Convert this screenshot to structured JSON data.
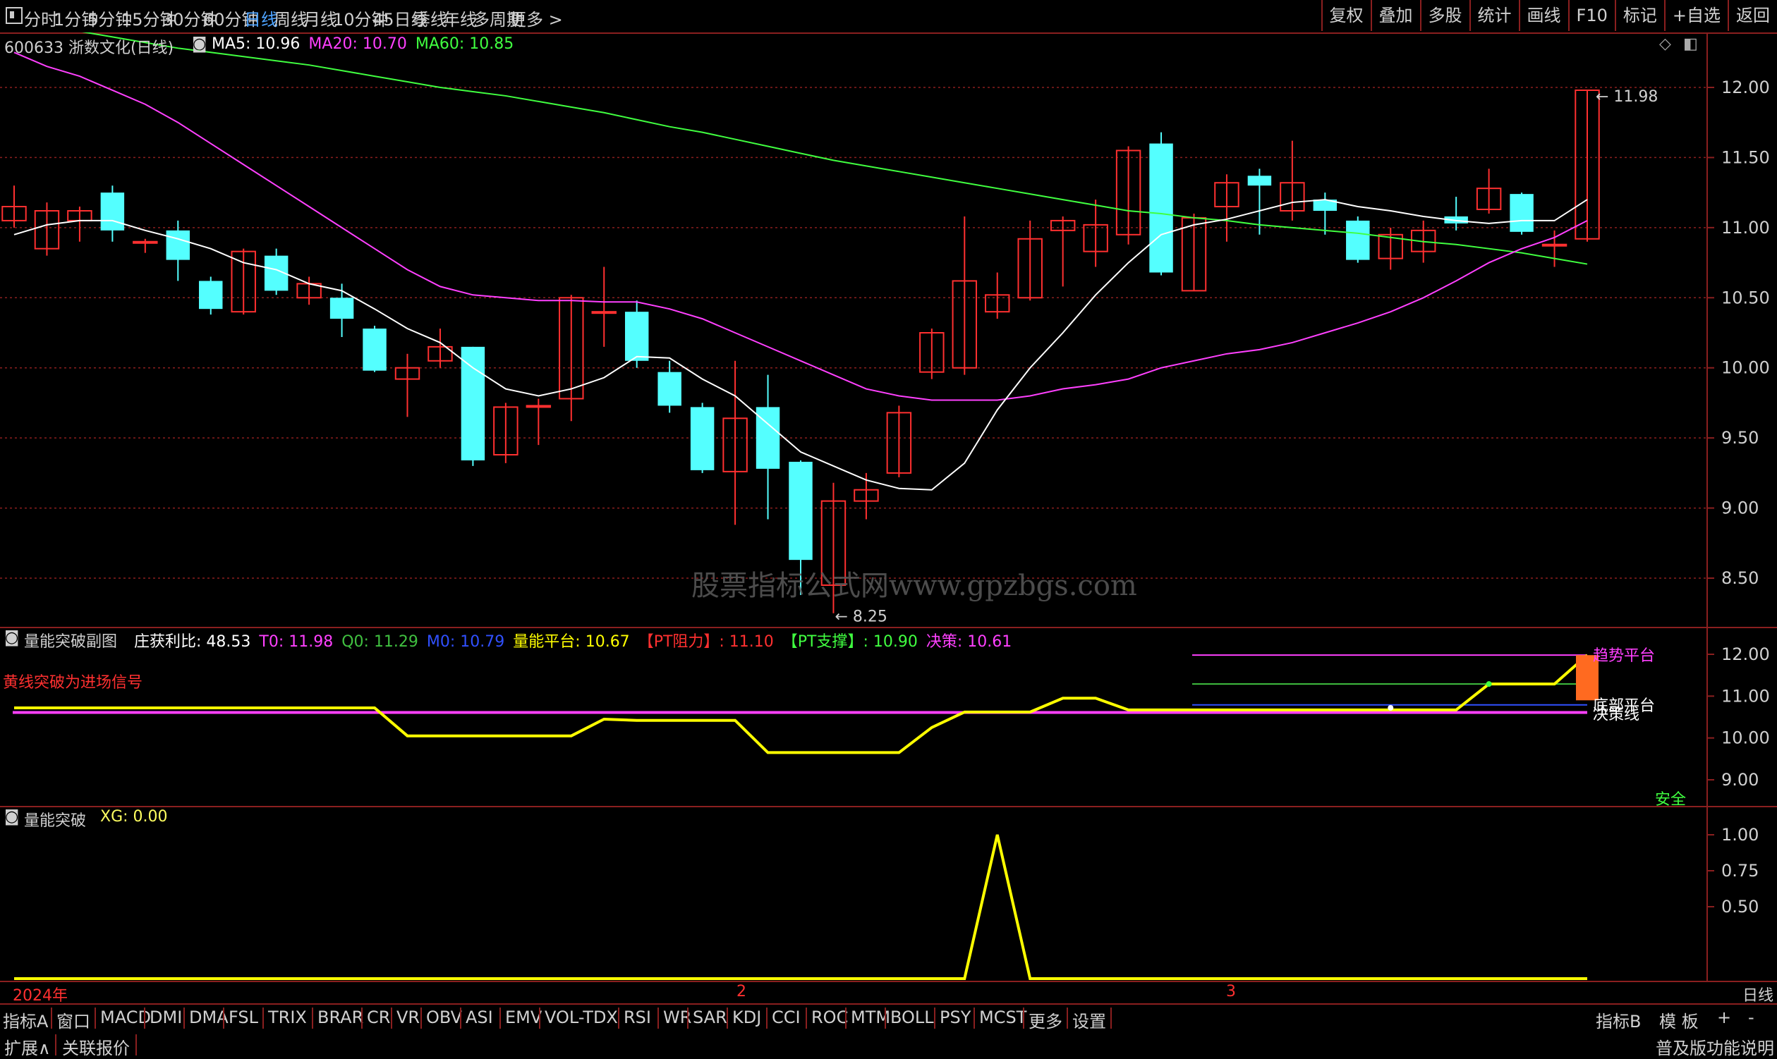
{
  "toolbar": {
    "periods": [
      "分时",
      "1分钟",
      "5分钟",
      "15分钟",
      "30分钟",
      "60分钟",
      "日线",
      "周线",
      "月线",
      "10分钟",
      "45日线",
      "季线",
      "年线",
      "多周期",
      "更多 >"
    ],
    "active_period": "日线",
    "right_buttons": [
      "复权",
      "叠加",
      "多股",
      "统计",
      "画线",
      "F10",
      "标记",
      "+自选",
      "返回"
    ]
  },
  "main_chart": {
    "title": "600633 浙数文化(日线)",
    "ma_labels": [
      {
        "text": "MA5: 10.96",
        "color": "#ffffff"
      },
      {
        "text": "MA20: 10.70",
        "color": "#ff40ff"
      },
      {
        "text": "MA60: 10.85",
        "color": "#40ff40"
      }
    ],
    "price_axis": [
      "12.50",
      "12.00",
      "11.50",
      "11.00",
      "10.50",
      "10.00",
      "9.50",
      "9.00",
      "8.50"
    ],
    "high_marker": "11.98",
    "low_marker": "8.25",
    "watermark": "股票指标公式网www.gpzbgs.com"
  },
  "sub_chart1": {
    "title": "量能突破副图",
    "items": [
      {
        "text": "庄获利比: 48.53",
        "color": "#ffffff"
      },
      {
        "text": "T0: 11.98",
        "color": "#ff40ff"
      },
      {
        "text": "Q0: 11.29",
        "color": "#40c040"
      },
      {
        "text": "M0: 10.79",
        "color": "#3050ff"
      },
      {
        "text": "量能平台: 10.67",
        "color": "#ffff00"
      },
      {
        "text": "【PT阻力】: 11.10",
        "color": "#ff3030"
      },
      {
        "text": "【PT支撑】: 10.90",
        "color": "#40ff40"
      },
      {
        "text": "决策: 10.61",
        "color": "#ff40ff"
      }
    ],
    "hint": "黄线突破为进场信号",
    "axis": [
      "12.00",
      "11.00",
      "10.00",
      "9.00"
    ],
    "right_labels": [
      "底部平台",
      "决策线",
      "趋势平台"
    ],
    "safe_label": "安全"
  },
  "sub_chart2": {
    "title": "量能突破",
    "xg": "XG: 0.00",
    "axis": [
      "1.00",
      "0.75",
      "0.50"
    ]
  },
  "time_axis": {
    "labels": [
      "2024年",
      "2",
      "3"
    ],
    "period_label": "日线"
  },
  "indicator_tabs": [
    "指标A",
    "窗口",
    "MACD",
    "DMI",
    "DMA",
    "FSL",
    "TRIX",
    "BRAR",
    "CR",
    "VR",
    "OBV",
    "ASI",
    "EMV",
    "VOL-TDX",
    "RSI",
    "WR",
    "SAR",
    "KDJ",
    "CCI",
    "ROC",
    "MTM",
    "BOLL",
    "PSY",
    "MCST",
    "更多",
    "设置"
  ],
  "indicator_right": [
    "指标B",
    "模 板",
    "+",
    "-"
  ],
  "status": {
    "expand": "扩展∧",
    "quote": "关联报价",
    "right": "普及版功能说明"
  },
  "colors": {
    "up": "#ff3030",
    "down": "#54ffff",
    "ma5": "#ffffff",
    "ma20": "#ff40ff",
    "ma60": "#40ff40",
    "grid": "#8a1f1f"
  },
  "chart_data": {
    "type": "candlestick",
    "candles": [
      {
        "o": 11.05,
        "c": 11.15,
        "h": 11.3,
        "l": 11.0
      },
      {
        "o": 10.85,
        "c": 11.12,
        "h": 11.18,
        "l": 10.8
      },
      {
        "o": 11.05,
        "c": 11.12,
        "h": 11.15,
        "l": 10.9
      },
      {
        "o": 11.25,
        "c": 10.98,
        "h": 11.3,
        "l": 10.9
      },
      {
        "o": 10.9,
        "c": 10.9,
        "h": 10.92,
        "l": 10.82
      },
      {
        "o": 10.98,
        "c": 10.77,
        "h": 11.05,
        "l": 10.62
      },
      {
        "o": 10.62,
        "c": 10.42,
        "h": 10.65,
        "l": 10.38
      },
      {
        "o": 10.4,
        "c": 10.83,
        "h": 10.85,
        "l": 10.38
      },
      {
        "o": 10.8,
        "c": 10.55,
        "h": 10.85,
        "l": 10.52
      },
      {
        "o": 10.5,
        "c": 10.6,
        "h": 10.65,
        "l": 10.45
      },
      {
        "o": 10.5,
        "c": 10.35,
        "h": 10.6,
        "l": 10.22
      },
      {
        "o": 10.28,
        "c": 9.98,
        "h": 10.3,
        "l": 9.97
      },
      {
        "o": 9.92,
        "c": 10.0,
        "h": 10.1,
        "l": 9.65
      },
      {
        "o": 10.05,
        "c": 10.15,
        "h": 10.28,
        "l": 10.0
      },
      {
        "o": 10.15,
        "c": 9.34,
        "h": 10.15,
        "l": 9.3
      },
      {
        "o": 9.38,
        "c": 9.72,
        "h": 9.75,
        "l": 9.32
      },
      {
        "o": 9.73,
        "c": 9.73,
        "h": 9.78,
        "l": 9.45
      },
      {
        "o": 9.78,
        "c": 10.5,
        "h": 10.52,
        "l": 9.62
      },
      {
        "o": 10.4,
        "c": 10.4,
        "h": 10.72,
        "l": 10.15
      },
      {
        "o": 10.4,
        "c": 10.05,
        "h": 10.48,
        "l": 10.0
      },
      {
        "o": 9.97,
        "c": 9.73,
        "h": 10.05,
        "l": 9.68
      },
      {
        "o": 9.72,
        "c": 9.27,
        "h": 9.75,
        "l": 9.25
      },
      {
        "o": 9.26,
        "c": 9.64,
        "h": 10.05,
        "l": 8.88
      },
      {
        "o": 9.72,
        "c": 9.28,
        "h": 9.95,
        "l": 8.92
      },
      {
        "o": 9.33,
        "c": 8.63,
        "h": 9.34,
        "l": 8.38
      },
      {
        "o": 8.45,
        "c": 9.05,
        "h": 9.18,
        "l": 8.25
      },
      {
        "o": 9.05,
        "c": 9.13,
        "h": 9.25,
        "l": 8.92
      },
      {
        "o": 9.25,
        "c": 9.68,
        "h": 9.73,
        "l": 9.22
      },
      {
        "o": 9.97,
        "c": 10.25,
        "h": 10.28,
        "l": 9.92
      },
      {
        "o": 10.0,
        "c": 10.62,
        "h": 11.08,
        "l": 9.95
      },
      {
        "o": 10.4,
        "c": 10.52,
        "h": 10.68,
        "l": 10.35
      },
      {
        "o": 10.5,
        "c": 10.92,
        "h": 11.05,
        "l": 10.48
      },
      {
        "o": 10.98,
        "c": 11.05,
        "h": 11.08,
        "l": 10.58
      },
      {
        "o": 10.83,
        "c": 11.02,
        "h": 11.2,
        "l": 10.72
      },
      {
        "o": 10.95,
        "c": 11.55,
        "h": 11.58,
        "l": 10.88
      },
      {
        "o": 11.6,
        "c": 10.68,
        "h": 11.68,
        "l": 10.66
      },
      {
        "o": 10.55,
        "c": 11.07,
        "h": 11.1,
        "l": 10.55
      },
      {
        "o": 11.15,
        "c": 11.32,
        "h": 11.38,
        "l": 10.9
      },
      {
        "o": 11.37,
        "c": 11.3,
        "h": 11.42,
        "l": 10.95
      },
      {
        "o": 11.12,
        "c": 11.32,
        "h": 11.62,
        "l": 11.05
      },
      {
        "o": 11.2,
        "c": 11.12,
        "h": 11.25,
        "l": 10.95
      },
      {
        "o": 11.05,
        "c": 10.77,
        "h": 11.08,
        "l": 10.75
      },
      {
        "o": 10.78,
        "c": 10.95,
        "h": 11.0,
        "l": 10.7
      },
      {
        "o": 10.83,
        "c": 10.98,
        "h": 11.05,
        "l": 10.75
      },
      {
        "o": 11.08,
        "c": 11.03,
        "h": 11.22,
        "l": 10.98
      },
      {
        "o": 11.13,
        "c": 11.28,
        "h": 11.42,
        "l": 11.1
      },
      {
        "o": 11.24,
        "c": 10.97,
        "h": 11.25,
        "l": 10.95
      },
      {
        "o": 10.88,
        "c": 10.88,
        "h": 10.98,
        "l": 10.72
      },
      {
        "o": 10.92,
        "c": 11.98,
        "h": 11.98,
        "l": 10.9
      }
    ],
    "ma5": [
      10.95,
      11.02,
      11.05,
      11.05,
      10.98,
      10.92,
      10.85,
      10.75,
      10.7,
      10.6,
      10.55,
      10.42,
      10.28,
      10.18,
      10.0,
      9.85,
      9.8,
      9.85,
      9.93,
      10.08,
      10.07,
      9.92,
      9.8,
      9.6,
      9.4,
      9.3,
      9.2,
      9.14,
      9.13,
      9.32,
      9.7,
      10.0,
      10.25,
      10.52,
      10.75,
      10.95,
      11.02,
      11.06,
      11.12,
      11.18,
      11.2,
      11.15,
      11.12,
      11.08,
      11.05,
      11.03,
      11.05,
      11.05,
      11.2
    ],
    "ma20": [
      12.25,
      12.15,
      12.08,
      11.98,
      11.88,
      11.75,
      11.6,
      11.45,
      11.3,
      11.15,
      11.0,
      10.85,
      10.7,
      10.58,
      10.52,
      10.5,
      10.48,
      10.48,
      10.47,
      10.47,
      10.42,
      10.35,
      10.25,
      10.15,
      10.05,
      9.95,
      9.85,
      9.8,
      9.77,
      9.77,
      9.77,
      9.8,
      9.85,
      9.88,
      9.92,
      10.0,
      10.05,
      10.1,
      10.13,
      10.18,
      10.25,
      10.32,
      10.4,
      10.5,
      10.62,
      10.75,
      10.85,
      10.93,
      11.05
    ],
    "ma60": [
      12.48,
      12.44,
      12.4,
      12.36,
      12.32,
      12.28,
      12.25,
      12.22,
      12.19,
      12.16,
      12.12,
      12.08,
      12.04,
      12.0,
      11.97,
      11.94,
      11.9,
      11.86,
      11.82,
      11.77,
      11.72,
      11.68,
      11.63,
      11.58,
      11.53,
      11.48,
      11.44,
      11.4,
      11.36,
      11.32,
      11.28,
      11.24,
      11.2,
      11.16,
      11.12,
      11.1,
      11.07,
      11.05,
      11.02,
      11.0,
      10.98,
      10.96,
      10.93,
      10.9,
      10.88,
      10.85,
      10.82,
      10.78,
      10.74
    ],
    "platform": [
      10.72,
      10.72,
      10.72,
      10.72,
      10.72,
      10.72,
      10.72,
      10.72,
      10.72,
      10.72,
      10.72,
      10.72,
      10.05,
      10.05,
      10.05,
      10.05,
      10.05,
      10.05,
      10.45,
      10.42,
      10.42,
      10.42,
      10.42,
      9.65,
      9.65,
      9.65,
      9.65,
      9.65,
      10.25,
      10.62,
      10.62,
      10.62,
      10.95,
      10.95,
      10.67,
      10.67,
      10.67,
      10.67,
      10.67,
      10.67,
      10.67,
      10.67,
      10.67,
      10.67,
      10.67,
      11.29,
      11.29,
      11.29,
      11.98
    ],
    "decision": 10.61,
    "resistance": 11.1,
    "support": 10.9,
    "t0": 11.98,
    "q0": 11.29,
    "m0": 10.79,
    "xg": [
      0,
      0,
      0,
      0,
      0,
      0,
      0,
      0,
      0,
      0,
      0,
      0,
      0,
      0,
      0,
      0,
      0,
      0,
      0,
      0,
      0,
      0,
      0,
      0,
      0,
      0,
      0,
      0,
      0,
      0,
      1,
      0,
      0,
      0,
      0,
      0,
      0,
      0,
      0,
      0,
      0,
      0,
      0,
      0,
      0,
      0,
      0,
      0,
      0
    ]
  }
}
